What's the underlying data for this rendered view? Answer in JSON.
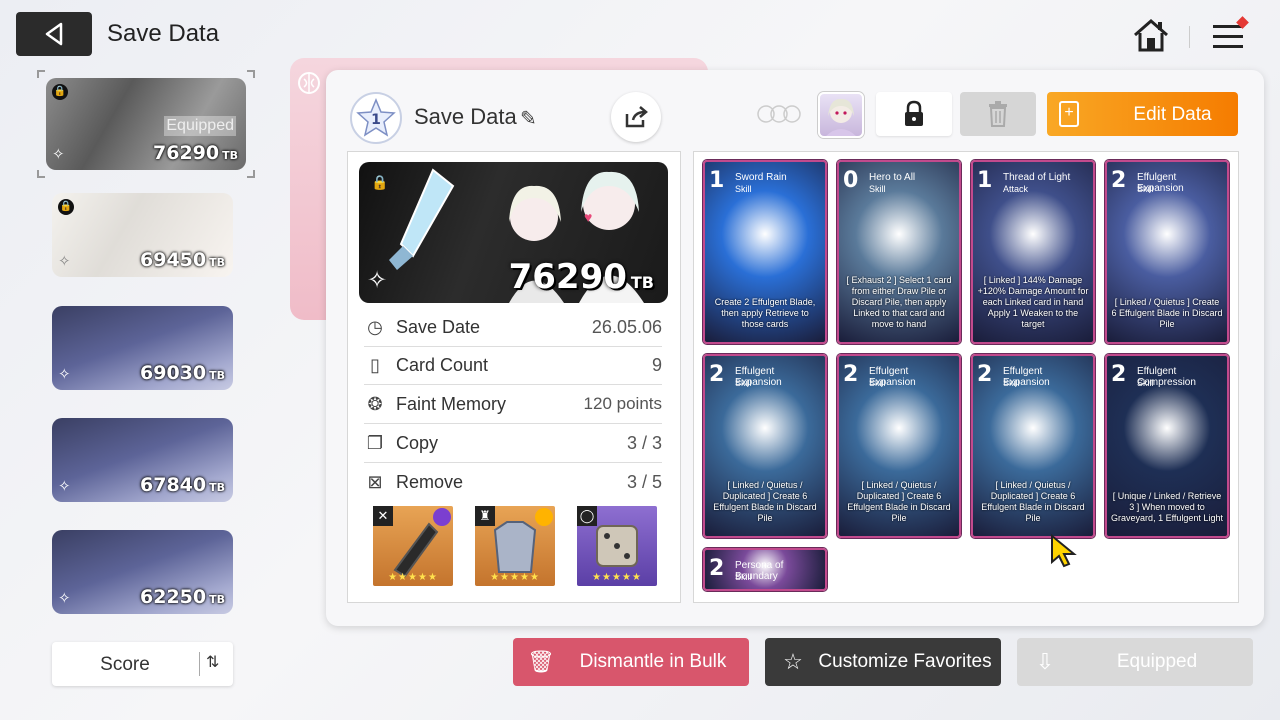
{
  "header": {
    "title": "Save Data"
  },
  "slots": [
    {
      "score": "76290",
      "unit": "TB",
      "status": "Equipped",
      "locked": true
    },
    {
      "score": "69450",
      "unit": "TB",
      "locked": true
    },
    {
      "score": "69030",
      "unit": "TB"
    },
    {
      "score": "67840",
      "unit": "TB"
    },
    {
      "score": "62250",
      "unit": "TB"
    }
  ],
  "sort": {
    "label": "Score"
  },
  "detail": {
    "rank": "1",
    "name": "Save Data",
    "score": "76290",
    "unit": "TB",
    "stats": [
      {
        "label": "Save Date",
        "value": "26.05.06"
      },
      {
        "label": "Card Count",
        "value": "9"
      },
      {
        "label": "Faint Memory",
        "value": "120 points"
      },
      {
        "label": "Copy",
        "value": "3 / 3"
      },
      {
        "label": "Remove",
        "value": "3 / 5"
      }
    ],
    "edit_label": "Edit Data"
  },
  "cards": [
    {
      "cost": "1",
      "name": "Sword Rain",
      "type": "Skill",
      "desc": "Create 2 Effulgent Blade, then apply Retrieve to those cards",
      "bg": "#2a6fd6"
    },
    {
      "cost": "0",
      "name": "Hero to All",
      "type": "Skill",
      "desc": "[ Exhaust 2 ] Select 1 card from either Draw Pile or Discard Pile, then apply Linked to that card and move to hand",
      "bg": "#5a7a9a"
    },
    {
      "cost": "1",
      "name": "Thread of Light",
      "type": "Attack",
      "desc": "[ Linked ] 144% Damage +120% Damage Amount for each Linked card in hand Apply 1 Weaken to the target",
      "bg": "#3f4f8a"
    },
    {
      "cost": "2",
      "name": "Effulgent Expansion",
      "type": "Skill",
      "desc": "[ Linked / Quietus ] Create 6 Effulgent Blade in Discard Pile",
      "bg": "#4a5da0"
    },
    {
      "cost": "2",
      "name": "Effulgent Expansion",
      "type": "Skill",
      "desc": "[ Linked / Quietus / Duplicated ] Create 6 Effulgent Blade in Discard Pile",
      "bg": "#3b6a9a"
    },
    {
      "cost": "2",
      "name": "Effulgent Expansion",
      "type": "Skill",
      "desc": "[ Linked / Quietus / Duplicated ] Create 6 Effulgent Blade in Discard Pile",
      "bg": "#3b6a9a"
    },
    {
      "cost": "2",
      "name": "Effulgent Expansion",
      "type": "Skill",
      "desc": "[ Linked / Quietus / Duplicated ] Create 6 Effulgent Blade in Discard Pile",
      "bg": "#3b6a9a"
    },
    {
      "cost": "2",
      "name": "Effulgent Compression",
      "type": "Skill",
      "desc": "[ Unique / Linked / Retrieve 3 ] When moved to Graveyard, 1 Effulgent Light",
      "bg": "#1e2f55"
    },
    {
      "cost": "2",
      "name": "Persona of Boundary",
      "type": "Skill",
      "desc": "",
      "bg": "#7a4a9a"
    }
  ],
  "bottom": {
    "bulk_label": "Dismantle in Bulk",
    "fav_label": "Customize Favorites",
    "equipped_label": "Equipped"
  },
  "colors": {
    "accent_orange": "#f57c00",
    "dismantle_red": "#d8566c",
    "card_border": "#c24a8d"
  }
}
